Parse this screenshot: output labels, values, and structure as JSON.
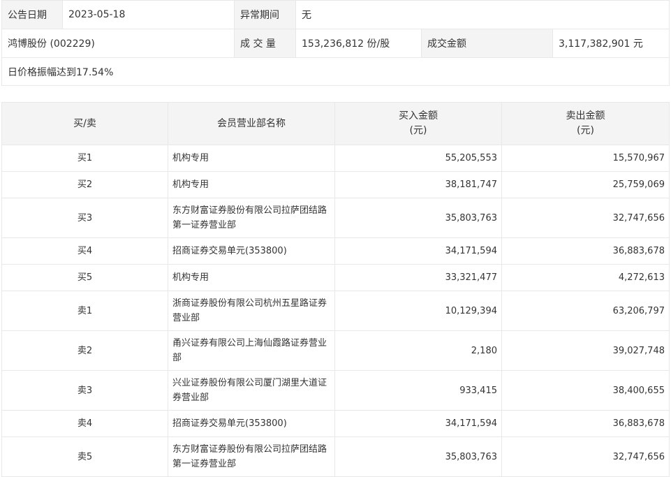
{
  "info": {
    "date_label": "公告日期",
    "date_value": "2023-05-18",
    "period_label": "异常期间",
    "period_value": "无",
    "stock": "鸿博股份 (002229)",
    "volume_label": "成 交 量",
    "volume_value": "153,236,812 份/股",
    "amount_label": "成交金额",
    "amount_value": "3,117,382,901 元",
    "reason": "日价格振幅达到17.54%"
  },
  "table": {
    "headers": {
      "side": "买/卖",
      "branch": "会员营业部名称",
      "buy_line1": "买入金额",
      "buy_line2": "(元)",
      "sell_line1": "卖出金额",
      "sell_line2": "(元)"
    },
    "rows": [
      {
        "side": "买1",
        "branch": "机构专用",
        "buy": "55,205,553",
        "sell": "15,570,967"
      },
      {
        "side": "买2",
        "branch": "机构专用",
        "buy": "38,181,747",
        "sell": "25,759,069"
      },
      {
        "side": "买3",
        "branch": "东方财富证券股份有限公司拉萨团结路第一证券营业部",
        "buy": "35,803,763",
        "sell": "32,747,656"
      },
      {
        "side": "买4",
        "branch": "招商证券交易单元(353800)",
        "buy": "34,171,594",
        "sell": "36,883,678"
      },
      {
        "side": "买5",
        "branch": "机构专用",
        "buy": "33,321,477",
        "sell": "4,272,613"
      },
      {
        "side": "卖1",
        "branch": "浙商证券股份有限公司杭州五星路证券营业部",
        "buy": "10,129,394",
        "sell": "63,206,797"
      },
      {
        "side": "卖2",
        "branch": "甬兴证券有限公司上海仙霞路证券营业部",
        "buy": "2,180",
        "sell": "39,027,748"
      },
      {
        "side": "卖3",
        "branch": "兴业证券股份有限公司厦门湖里大道证券营业部",
        "buy": "933,415",
        "sell": "38,400,655"
      },
      {
        "side": "卖4",
        "branch": "招商证券交易单元(353800)",
        "buy": "34,171,594",
        "sell": "36,883,678"
      },
      {
        "side": "卖5",
        "branch": "东方财富证券股份有限公司拉萨团结路第一证券营业部",
        "buy": "35,803,763",
        "sell": "32,747,656"
      }
    ]
  }
}
